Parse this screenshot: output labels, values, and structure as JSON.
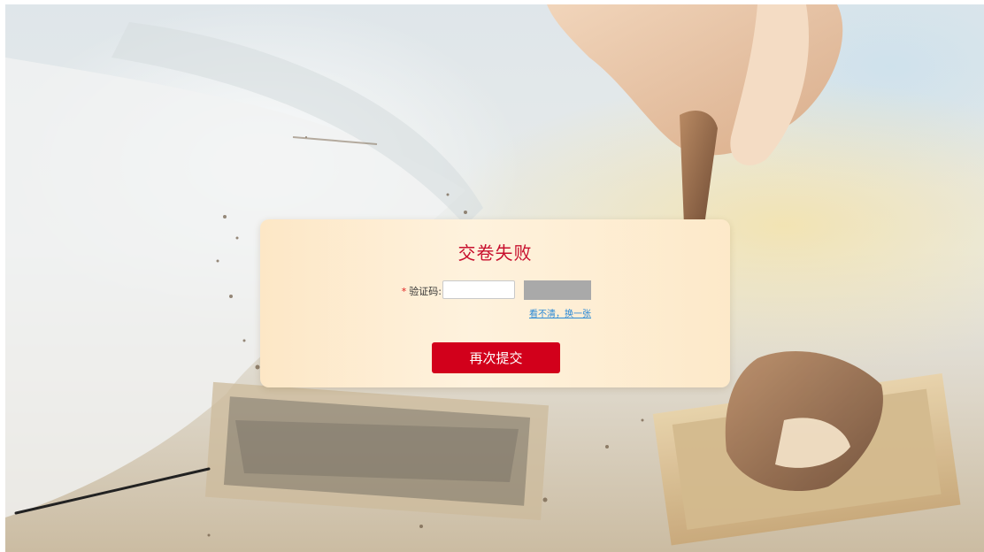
{
  "dialog": {
    "title": "交卷失败",
    "required_mark": "*",
    "captcha_label": "验证码:",
    "captcha_value": "",
    "refresh_link": "看不清，换一张",
    "submit_label": "再次提交"
  },
  "colors": {
    "accent": "#c8102e",
    "button": "#d2001b",
    "link": "#2a8ad6",
    "dialog_background": "#fdebcf",
    "captcha_placeholder": "#a9a9a9"
  }
}
